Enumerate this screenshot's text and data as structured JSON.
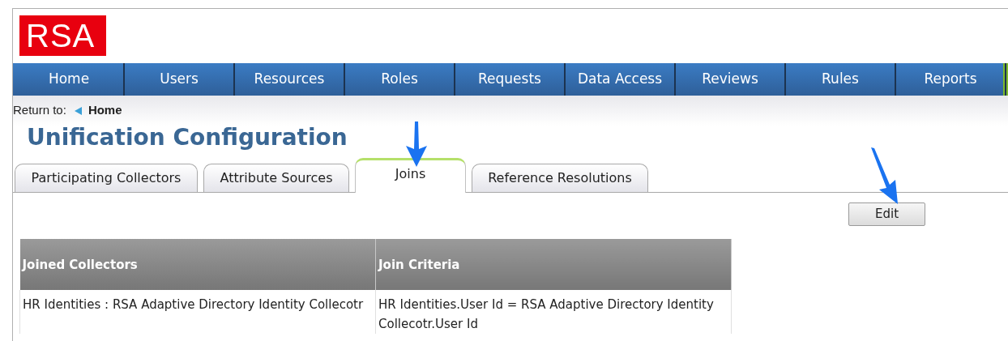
{
  "logo": {
    "text": "RSA"
  },
  "nav": [
    {
      "label": "Home"
    },
    {
      "label": "Users"
    },
    {
      "label": "Resources"
    },
    {
      "label": "Roles"
    },
    {
      "label": "Requests"
    },
    {
      "label": "Data Access"
    },
    {
      "label": "Reviews"
    },
    {
      "label": "Rules"
    },
    {
      "label": "Reports"
    }
  ],
  "breadcrumb": {
    "prefix": "Return to:",
    "link": "Home"
  },
  "title": "Unification Configuration",
  "tabs": [
    {
      "label": "Participating Collectors",
      "selected": false
    },
    {
      "label": "Attribute Sources",
      "selected": false
    },
    {
      "label": "Joins",
      "selected": true
    },
    {
      "label": "Reference Resolutions",
      "selected": false
    }
  ],
  "edit_button": "Edit",
  "table": {
    "columns": [
      "Joined Collectors",
      "Join Criteria"
    ],
    "rows": [
      [
        "HR Identities : RSA Adaptive Directory Identity Collecotr",
        "HR Identities.User Id = RSA Adaptive Directory Identity Collecotr.User Id"
      ]
    ]
  }
}
